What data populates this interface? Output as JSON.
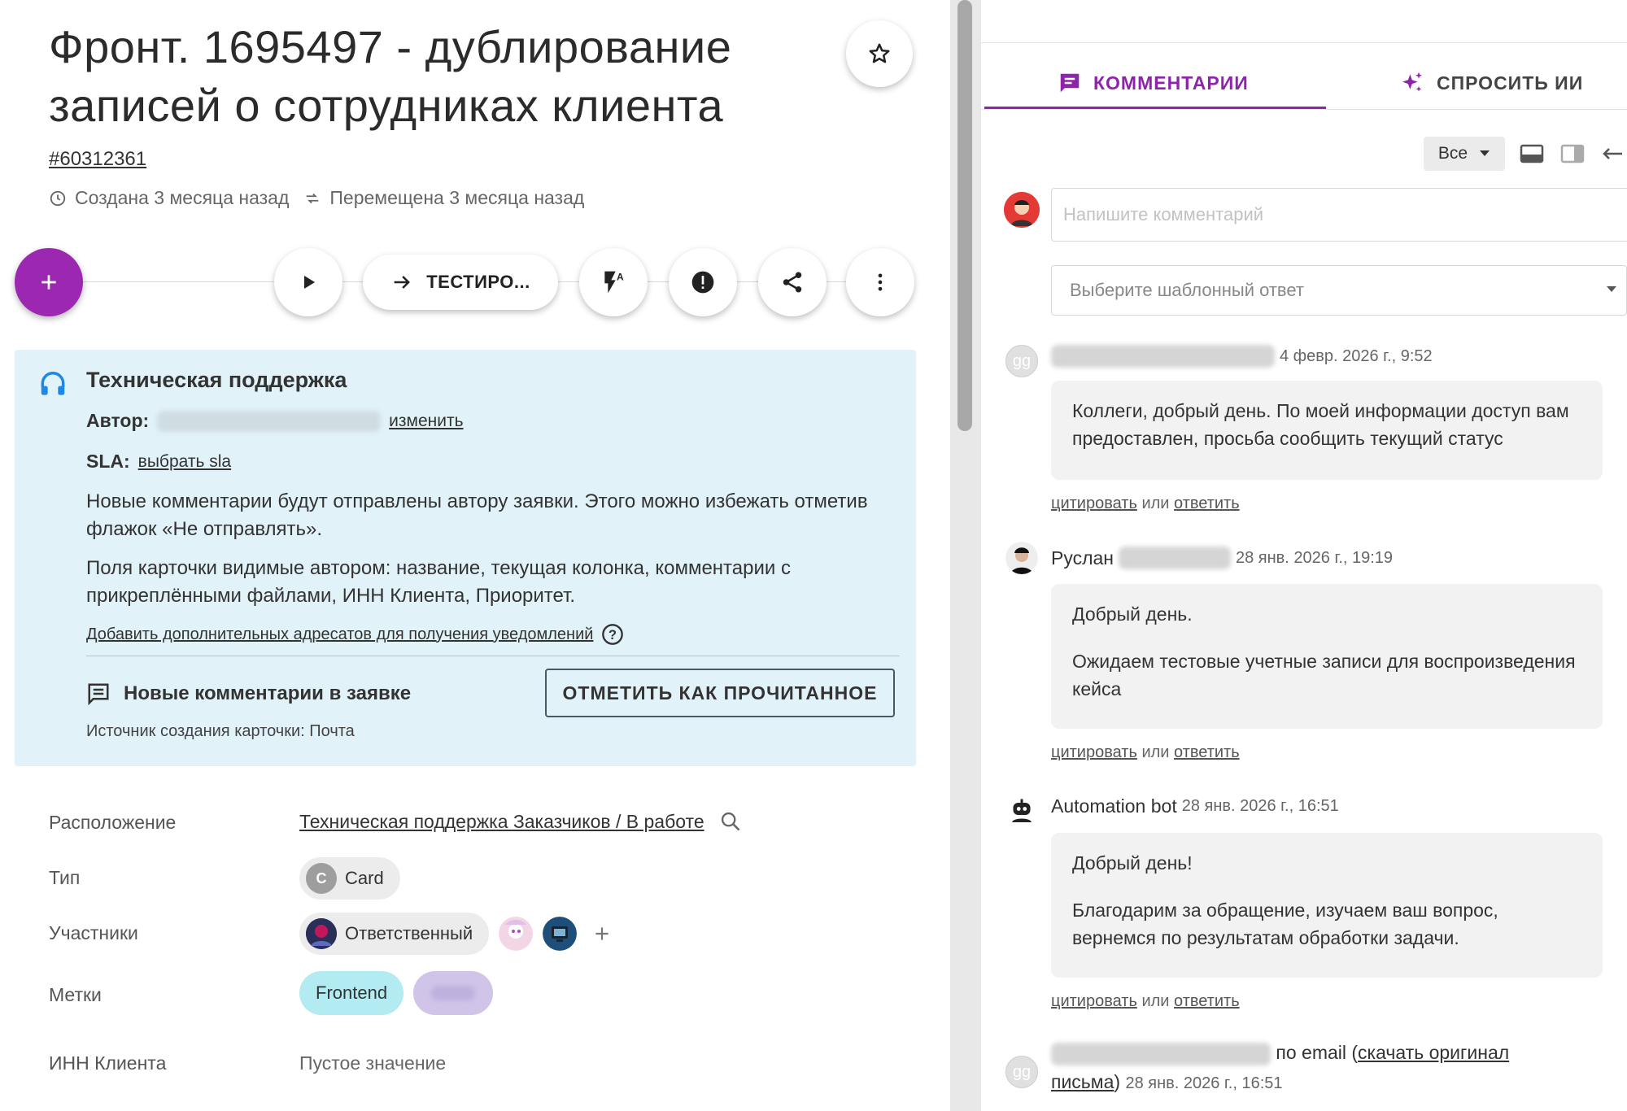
{
  "card": {
    "title": "Фронт. 1695497 - дублирование записей о сотрудниках клиента",
    "id": "#60312361",
    "created": "Создана 3 месяца назад",
    "moved": "Перемещена 3 месяца назад"
  },
  "toolbar": {
    "move_label": "ТЕСТИРО..."
  },
  "info": {
    "title": "Техническая поддержка",
    "author_label": "Автор:",
    "change_link": "изменить",
    "sla_label": "SLA:",
    "sla_link": "выбрать sla",
    "notice_1": "Новые комментарии будут отправлены автору заявки. Этого можно избежать отметив флажок «Не отправлять».",
    "notice_2": "Поля карточки видимые автором: название, текущая колонка, комментарии с прикреплёнными файлами, ИНН Клиента, Приоритет.",
    "add_recipients_link": "Добавить дополнительных адресатов для получения уведомлений",
    "new_comments": "Новые комментарии в заявке",
    "mark_read": "ОТМЕТИТЬ КАК ПРОЧИТАННОЕ",
    "source": "Источник создания карточки: Почта"
  },
  "fields": {
    "location_label": "Расположение",
    "location_value": "Техническая поддержка Заказчиков / В работе",
    "type_label": "Тип",
    "type_letter": "C",
    "type_value": "Card",
    "members_label": "Участники",
    "responsible": "Ответственный",
    "tags_label": "Метки",
    "tag_1": "Frontend",
    "inn_label": "ИНН Клиента",
    "inn_value": "Пустое значение"
  },
  "panel": {
    "tab_comments": "КОММЕНТАРИИ",
    "tab_ai": "СПРОСИТЬ ИИ",
    "filter": "Все",
    "comment_placeholder": "Напишите комментарий",
    "template_placeholder": "Выберите шаблонный ответ"
  },
  "comments": [
    {
      "avatar": "gg",
      "author": "",
      "date": "4 февр. 2026 г., 9:52",
      "paragraphs": [
        "Коллеги, добрый день. По моей информации доступ вам предоставлен, просьба сообщить текущий статус"
      ]
    },
    {
      "avatar": "",
      "author": "Руслан",
      "date": "28 янв. 2026 г., 19:19",
      "paragraphs": [
        "Добрый день.",
        "Ожидаем тестовые учетные записи для воспроизведения кейса"
      ]
    },
    {
      "avatar": "",
      "author": "Automation bot",
      "date": "28 янв. 2026 г., 16:51",
      "paragraphs": [
        "Добрый день!",
        "Благодарим за обращение, изучаем ваш вопрос, вернемся по результатам обработки задачи."
      ]
    },
    {
      "avatar": "gg",
      "author": "",
      "email_prefix": "по email (",
      "email_link": "скачать оригинал письма",
      "email_suffix": ")",
      "date": "28 янв. 2026 г., 16:51"
    }
  ],
  "comment_actions": {
    "quote": "цитировать",
    "or": "или",
    "reply": "ответить"
  },
  "colors": {
    "accent": "#9c27b0",
    "info_bg": "#e1f2f8",
    "tag_frontend": "#b2ebf2",
    "tag_blurred": "#d1c4e9"
  }
}
